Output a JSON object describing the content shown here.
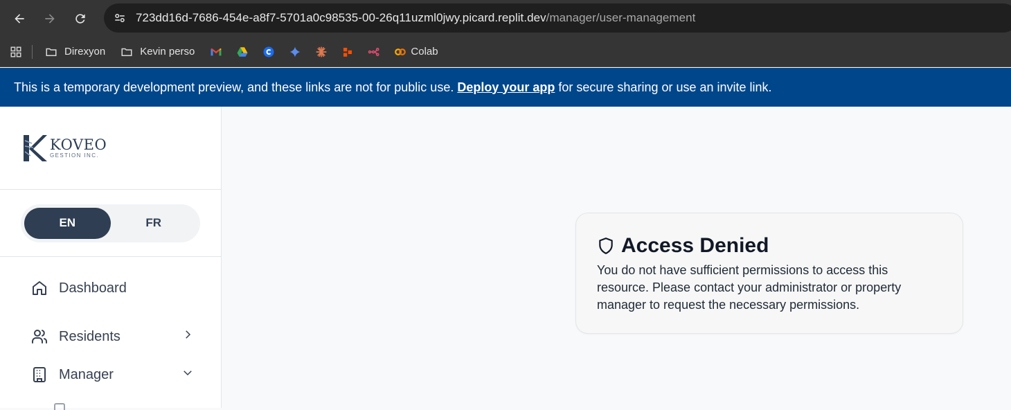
{
  "browser": {
    "url_host": "723dd16d-7686-454e-a8f7-5701a0c98535-00-26q11uzml0jwy.picard.replit.dev",
    "url_path": "/manager/user-management",
    "bookmarks": [
      {
        "label": "Direxyon",
        "icon": "folder-icon"
      },
      {
        "label": "Kevin perso",
        "icon": "folder-icon"
      },
      {
        "label": "",
        "icon": "gmail-icon"
      },
      {
        "label": "",
        "icon": "google-drive-icon"
      },
      {
        "label": "",
        "icon": "c-app-icon"
      },
      {
        "label": "",
        "icon": "gemini-icon"
      },
      {
        "label": "",
        "icon": "claude-icon"
      },
      {
        "label": "",
        "icon": "zapier-icon"
      },
      {
        "label": "",
        "icon": "n8n-icon"
      },
      {
        "label": "Colab",
        "icon": "colab-icon"
      }
    ]
  },
  "banner": {
    "text_before": "This is a temporary development preview, and these links are not for public use.",
    "link": "Deploy your app",
    "text_after": "for secure sharing or use an invite link.",
    "color": "#00468b"
  },
  "sidebar": {
    "logo": {
      "title": "KOVEO",
      "subtitle": "GESTION INC."
    },
    "languages": [
      {
        "label": "EN",
        "active": true
      },
      {
        "label": "FR",
        "active": false
      }
    ],
    "nav": [
      {
        "label": "Dashboard",
        "icon": "home-icon"
      },
      {
        "label": "Residents",
        "icon": "users-icon",
        "chevron": "chevron-right-icon"
      },
      {
        "label": "Manager",
        "icon": "building-icon",
        "chevron": "chevron-down-icon"
      }
    ]
  },
  "main": {
    "access_card": {
      "title": "Access Denied",
      "icon": "shield-icon",
      "message": "You do not have sufficient permissions to access this resource. Please contact your administrator or property manager to request the necessary permissions."
    }
  }
}
